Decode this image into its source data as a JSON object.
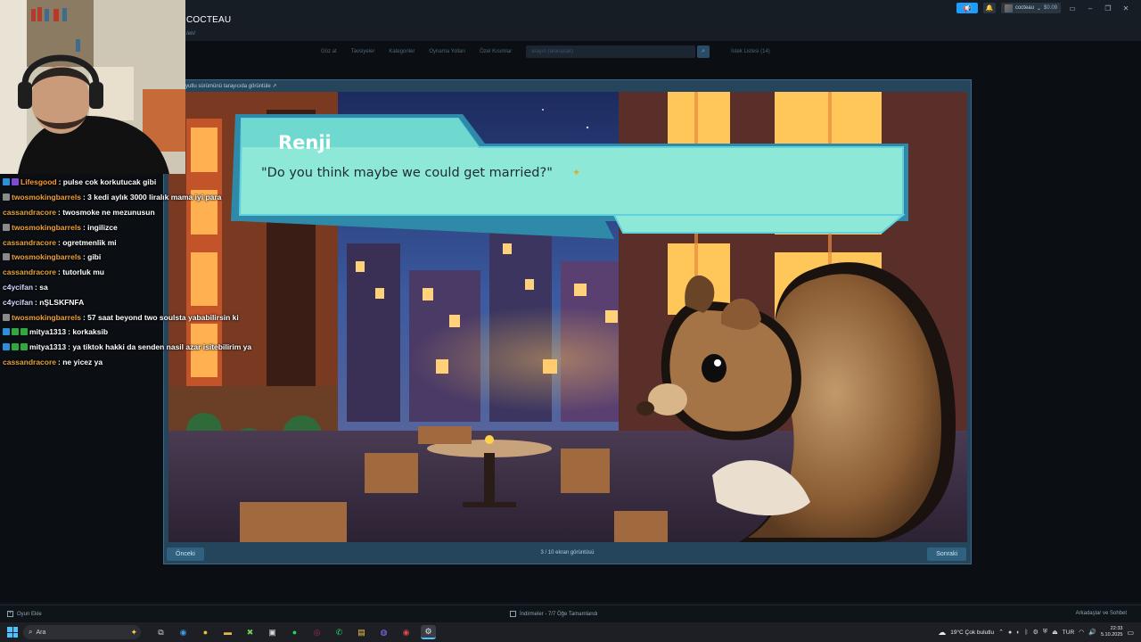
{
  "steam": {
    "app_title": "COCTEAU",
    "url_fragment": "/en/",
    "announce_icon": "megaphone-icon",
    "username": "cocteau",
    "wallet": "$0.09",
    "nav": {
      "items": [
        "Göz at",
        "Tavsiyeler",
        "Kategoriler",
        "Oynama Yolları",
        "Özel Kısımlar"
      ],
      "search_placeholder": "arayın (aranacak)",
      "wishlist": "İstek Listesi (14)"
    }
  },
  "modal": {
    "title_link": "yutlu sürümünü tarayıcıda görüntüle ↗",
    "prev_label": "Önceki",
    "next_label": "Sonraki",
    "counter": "3 / 10 ekran görüntüsü"
  },
  "game_scene": {
    "speaker": "Renji",
    "dialogue": "\"Do you think maybe we could get married?\""
  },
  "chat": [
    {
      "badges": [
        "blue",
        "purple"
      ],
      "user": "Lifesgood",
      "color": "#ff9a2e",
      "msg": ": pulse cok korkutucak gibi"
    },
    {
      "badges": [
        "gray"
      ],
      "user": "twosmokingbarrels",
      "color": "#f0a13a",
      "msg": ": 3 kedi aylık 3000 liralık mama iyi para"
    },
    {
      "badges": [],
      "user": "cassandracore",
      "color": "#e6a23c",
      "msg": ": twosmoke ne mezunusun"
    },
    {
      "badges": [
        "gray"
      ],
      "user": "twosmokingbarrels",
      "color": "#f0a13a",
      "msg": ": ingilizce"
    },
    {
      "badges": [],
      "user": "cassandracore",
      "color": "#e6a23c",
      "msg": ": ogretmenlik mi"
    },
    {
      "badges": [
        "gray"
      ],
      "user": "twosmokingbarrels",
      "color": "#f0a13a",
      "msg": ": gibi"
    },
    {
      "badges": [],
      "user": "cassandracore",
      "color": "#e6a23c",
      "msg": ": tutorluk mu"
    },
    {
      "badges": [],
      "user": "c4ycifan",
      "color": "#d7d7ff",
      "msg": ": sa"
    },
    {
      "badges": [],
      "user": "c4ycifan",
      "color": "#d7d7ff",
      "msg": ": nŞLSKFNFA"
    },
    {
      "badges": [
        "gray"
      ],
      "user": "twosmokingbarrels",
      "color": "#f0a13a",
      "msg": ": 57 saat beyond two soulsta yababilirsin ki"
    },
    {
      "badges": [
        "blue",
        "green",
        "green"
      ],
      "user": "mitya1313",
      "color": "#ffffff",
      "msg": ": korkaksib"
    },
    {
      "badges": [
        "blue",
        "green",
        "green"
      ],
      "user": "mitya1313",
      "color": "#ffffff",
      "msg": ": ya tiktok hakki da senden nasil azar isitebilirim ya"
    },
    {
      "badges": [],
      "user": "cassandracore",
      "color": "#e6a23c",
      "msg": ": ne yicez ya"
    }
  ],
  "bottom_bar": {
    "add_game": "Oyun Ekle",
    "downloads": "İndirmeler - 7/7 Öğe Tamamlandı",
    "friends": "Arkadaşlar ve Sohbet"
  },
  "taskbar": {
    "search_placeholder": "Ara",
    "weather": "19°C  Çok bulutlu",
    "lang": "TUR",
    "time": "22:33",
    "date": "5.10.2025"
  }
}
